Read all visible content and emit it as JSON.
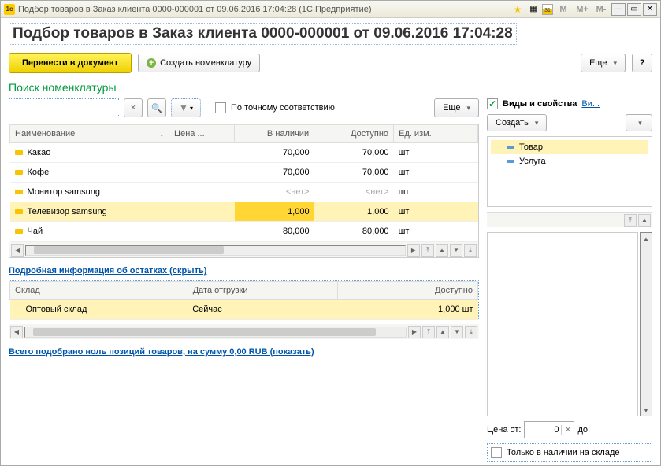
{
  "title_bar": {
    "text": "Подбор товаров в Заказ клиента 0000-000001 от 09.06.2016 17:04:28  (1С:Предприятие)",
    "cal_text": "31"
  },
  "page": {
    "title": "Подбор товаров в Заказ клиента 0000-000001 от 09.06.2016 17:04:28"
  },
  "toolbar": {
    "transfer": "Перенести в документ",
    "create_nom": "Создать номенклатуру",
    "more": "Еще",
    "help": "?"
  },
  "search": {
    "heading": "Поиск номенклатуры",
    "exact_match": "По точному соответствию",
    "more": "Еще"
  },
  "table": {
    "headers": {
      "name": "Наименование",
      "price": "Цена ...",
      "stock": "В наличии",
      "avail": "Доступно",
      "unit": "Ед. изм."
    },
    "rows": [
      {
        "name": "Какао",
        "stock": "70,000",
        "avail": "70,000",
        "unit": "шт"
      },
      {
        "name": "Кофе",
        "stock": "70,000",
        "avail": "70,000",
        "unit": "шт"
      },
      {
        "name": "Монитор samsung",
        "stock": "<нет>",
        "avail": "<нет>",
        "unit": "шт",
        "net": true
      },
      {
        "name": "Телевизор samsung",
        "stock": "1,000",
        "avail": "1,000",
        "unit": "шт",
        "selected": true
      },
      {
        "name": "Чай",
        "stock": "80,000",
        "avail": "80,000",
        "unit": "шт"
      }
    ]
  },
  "details_link": "Подробная информация об остатках (скрыть)",
  "stock_table": {
    "headers": {
      "wh": "Склад",
      "date": "Дата отгрузки",
      "avail": "Доступно"
    },
    "row": {
      "wh": "Оптовый склад",
      "date": "Сейчас",
      "avail": "1,000 шт"
    }
  },
  "summary_link": "Всего подобрано ноль позиций товаров, на сумму 0,00 RUB (показать)",
  "right": {
    "header": "Виды и свойства",
    "header_link": "Ви...",
    "create": "Создать",
    "tree": {
      "item1": "Товар",
      "item2": "Услуга"
    },
    "price_from": "Цена от:",
    "price_val": "0",
    "price_to": "до:",
    "only_stock": "Только в наличии на складе"
  }
}
